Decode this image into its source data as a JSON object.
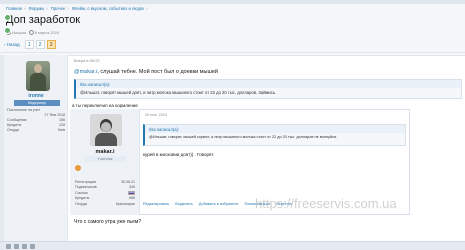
{
  "breadcrumb": [
    "Главная",
    "Форумы",
    "Прочее",
    "Флейм, о вкусном, событиях и людях"
  ],
  "thread": {
    "title": "Доп заработок",
    "author": "Ильшат",
    "date": "8 марта 2024"
  },
  "pager": {
    "prev_label": "Назад",
    "pages": [
      "1",
      "2",
      "3"
    ],
    "active": "3"
  },
  "post": {
    "user": {
      "name": "ironne",
      "role": "Модератор",
      "stats": [
        {
          "label": "Постоянное на учет",
          "value": ""
        },
        {
          "label": "",
          "value": "27 Янв 2018"
        },
        {
          "label": "Сообщения",
          "value": "156"
        },
        {
          "label": "Кредиты",
          "value": "228"
        },
        {
          "label": "Откуда",
          "value": "Київ"
        }
      ]
    },
    "date": "Вчера в 06:22",
    "mention": "@makar.i",
    "text": ", слушай тебне. Мой пост был о доевки мышей",
    "quote": {
      "author": "Ilsa написал(а):",
      "text": "@Ильшат, говорят мышей доят, и литр молока мышиного стоит от 22 до 20 тыс. долларов. Займись."
    },
    "text2": "а ты переключил на кормление"
  },
  "nested": {
    "user": {
      "name": "makar.i",
      "role": "Участник",
      "stats": [
        {
          "label": "Регистрация",
          "value": "30.06.21"
        },
        {
          "label": "Подписчиков",
          "value": "345"
        },
        {
          "label": "Ссылки",
          "value": "flag"
        },
        {
          "label": "Кредиты",
          "value": "666"
        },
        {
          "label": "Откуда",
          "value": "Красноярск"
        }
      ]
    },
    "date": "20 ноя. 2024",
    "quote": {
      "author": "Ilsa написал(а):",
      "text": "@Ильшат, говорят, мышей кормят, а литр мышиного молока стоит от 22 до 20 тыс. долларов не волнуйся."
    },
    "text": "курей в московии доят)) . Говорят.",
    "actions": [
      "Редактировать",
      "Выделить",
      "Добавить в избранное",
      "Пожаловаться",
      "Ответить"
    ]
  },
  "watermark": "https://freeservis.com.ua",
  "bottom_text": "Что с самого утра уже пьем?"
}
